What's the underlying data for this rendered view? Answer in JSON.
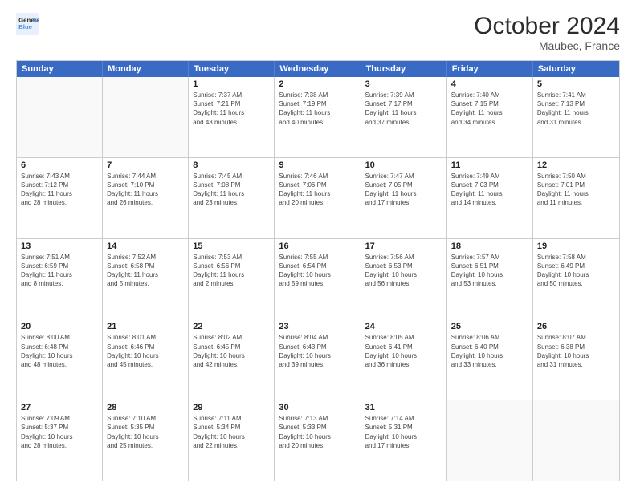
{
  "header": {
    "logo_line1": "General",
    "logo_line2": "Blue",
    "month": "October 2024",
    "location": "Maubec, France"
  },
  "weekdays": [
    "Sunday",
    "Monday",
    "Tuesday",
    "Wednesday",
    "Thursday",
    "Friday",
    "Saturday"
  ],
  "weeks": [
    [
      {
        "day": "",
        "info": ""
      },
      {
        "day": "",
        "info": ""
      },
      {
        "day": "1",
        "info": "Sunrise: 7:37 AM\nSunset: 7:21 PM\nDaylight: 11 hours\nand 43 minutes."
      },
      {
        "day": "2",
        "info": "Sunrise: 7:38 AM\nSunset: 7:19 PM\nDaylight: 11 hours\nand 40 minutes."
      },
      {
        "day": "3",
        "info": "Sunrise: 7:39 AM\nSunset: 7:17 PM\nDaylight: 11 hours\nand 37 minutes."
      },
      {
        "day": "4",
        "info": "Sunrise: 7:40 AM\nSunset: 7:15 PM\nDaylight: 11 hours\nand 34 minutes."
      },
      {
        "day": "5",
        "info": "Sunrise: 7:41 AM\nSunset: 7:13 PM\nDaylight: 11 hours\nand 31 minutes."
      }
    ],
    [
      {
        "day": "6",
        "info": "Sunrise: 7:43 AM\nSunset: 7:12 PM\nDaylight: 11 hours\nand 28 minutes."
      },
      {
        "day": "7",
        "info": "Sunrise: 7:44 AM\nSunset: 7:10 PM\nDaylight: 11 hours\nand 26 minutes."
      },
      {
        "day": "8",
        "info": "Sunrise: 7:45 AM\nSunset: 7:08 PM\nDaylight: 11 hours\nand 23 minutes."
      },
      {
        "day": "9",
        "info": "Sunrise: 7:46 AM\nSunset: 7:06 PM\nDaylight: 11 hours\nand 20 minutes."
      },
      {
        "day": "10",
        "info": "Sunrise: 7:47 AM\nSunset: 7:05 PM\nDaylight: 11 hours\nand 17 minutes."
      },
      {
        "day": "11",
        "info": "Sunrise: 7:49 AM\nSunset: 7:03 PM\nDaylight: 11 hours\nand 14 minutes."
      },
      {
        "day": "12",
        "info": "Sunrise: 7:50 AM\nSunset: 7:01 PM\nDaylight: 11 hours\nand 11 minutes."
      }
    ],
    [
      {
        "day": "13",
        "info": "Sunrise: 7:51 AM\nSunset: 6:59 PM\nDaylight: 11 hours\nand 8 minutes."
      },
      {
        "day": "14",
        "info": "Sunrise: 7:52 AM\nSunset: 6:58 PM\nDaylight: 11 hours\nand 5 minutes."
      },
      {
        "day": "15",
        "info": "Sunrise: 7:53 AM\nSunset: 6:56 PM\nDaylight: 11 hours\nand 2 minutes."
      },
      {
        "day": "16",
        "info": "Sunrise: 7:55 AM\nSunset: 6:54 PM\nDaylight: 10 hours\nand 59 minutes."
      },
      {
        "day": "17",
        "info": "Sunrise: 7:56 AM\nSunset: 6:53 PM\nDaylight: 10 hours\nand 56 minutes."
      },
      {
        "day": "18",
        "info": "Sunrise: 7:57 AM\nSunset: 6:51 PM\nDaylight: 10 hours\nand 53 minutes."
      },
      {
        "day": "19",
        "info": "Sunrise: 7:58 AM\nSunset: 6:49 PM\nDaylight: 10 hours\nand 50 minutes."
      }
    ],
    [
      {
        "day": "20",
        "info": "Sunrise: 8:00 AM\nSunset: 6:48 PM\nDaylight: 10 hours\nand 48 minutes."
      },
      {
        "day": "21",
        "info": "Sunrise: 8:01 AM\nSunset: 6:46 PM\nDaylight: 10 hours\nand 45 minutes."
      },
      {
        "day": "22",
        "info": "Sunrise: 8:02 AM\nSunset: 6:45 PM\nDaylight: 10 hours\nand 42 minutes."
      },
      {
        "day": "23",
        "info": "Sunrise: 8:04 AM\nSunset: 6:43 PM\nDaylight: 10 hours\nand 39 minutes."
      },
      {
        "day": "24",
        "info": "Sunrise: 8:05 AM\nSunset: 6:41 PM\nDaylight: 10 hours\nand 36 minutes."
      },
      {
        "day": "25",
        "info": "Sunrise: 8:06 AM\nSunset: 6:40 PM\nDaylight: 10 hours\nand 33 minutes."
      },
      {
        "day": "26",
        "info": "Sunrise: 8:07 AM\nSunset: 6:38 PM\nDaylight: 10 hours\nand 31 minutes."
      }
    ],
    [
      {
        "day": "27",
        "info": "Sunrise: 7:09 AM\nSunset: 5:37 PM\nDaylight: 10 hours\nand 28 minutes."
      },
      {
        "day": "28",
        "info": "Sunrise: 7:10 AM\nSunset: 5:35 PM\nDaylight: 10 hours\nand 25 minutes."
      },
      {
        "day": "29",
        "info": "Sunrise: 7:11 AM\nSunset: 5:34 PM\nDaylight: 10 hours\nand 22 minutes."
      },
      {
        "day": "30",
        "info": "Sunrise: 7:13 AM\nSunset: 5:33 PM\nDaylight: 10 hours\nand 20 minutes."
      },
      {
        "day": "31",
        "info": "Sunrise: 7:14 AM\nSunset: 5:31 PM\nDaylight: 10 hours\nand 17 minutes."
      },
      {
        "day": "",
        "info": ""
      },
      {
        "day": "",
        "info": ""
      }
    ]
  ]
}
